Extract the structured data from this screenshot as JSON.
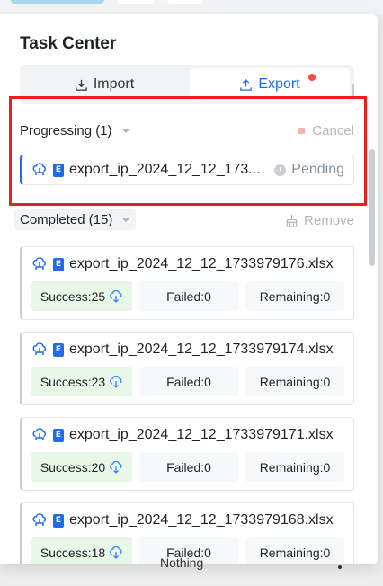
{
  "panel": {
    "title": "Task Center",
    "tabs": {
      "import_label": "Import",
      "export_label": "Export"
    }
  },
  "progressing": {
    "header": "Progressing (1)",
    "cancel_label": "Cancel",
    "task": {
      "file_name": "export_ip_2024_12_12_173...",
      "status": "Pending",
      "file_badge": "E"
    }
  },
  "completed": {
    "header": "Completed (15)",
    "remove_label": "Remove",
    "items": [
      {
        "file_name": "export_ip_2024_12_12_1733979176.xlsx",
        "success": "Success:25",
        "failed": "Failed:0",
        "remaining": "Remaining:0",
        "file_badge": "E"
      },
      {
        "file_name": "export_ip_2024_12_12_1733979174.xlsx",
        "success": "Success:23",
        "failed": "Failed:0",
        "remaining": "Remaining:0",
        "file_badge": "E"
      },
      {
        "file_name": "export_ip_2024_12_12_1733979171.xlsx",
        "success": "Success:20",
        "failed": "Failed:0",
        "remaining": "Remaining:0",
        "file_badge": "E"
      },
      {
        "file_name": "export_ip_2024_12_12_1733979168.xlsx",
        "success": "Success:18",
        "failed": "Failed:0",
        "remaining": "Remaining:0",
        "file_badge": "E"
      }
    ]
  },
  "background": {
    "text": "Nothing"
  },
  "colors": {
    "accent": "#1e6ce8",
    "highlight_border": "#f01d1d",
    "notification_dot": "#f54a45",
    "success_bg": "#e8f7e8"
  },
  "icons": [
    "download-icon",
    "upload-icon",
    "notification-dot",
    "cancel-square-icon",
    "cloud-network-icon",
    "excel-file-icon",
    "clock-icon",
    "broom-icon",
    "cloud-download-icon"
  ]
}
